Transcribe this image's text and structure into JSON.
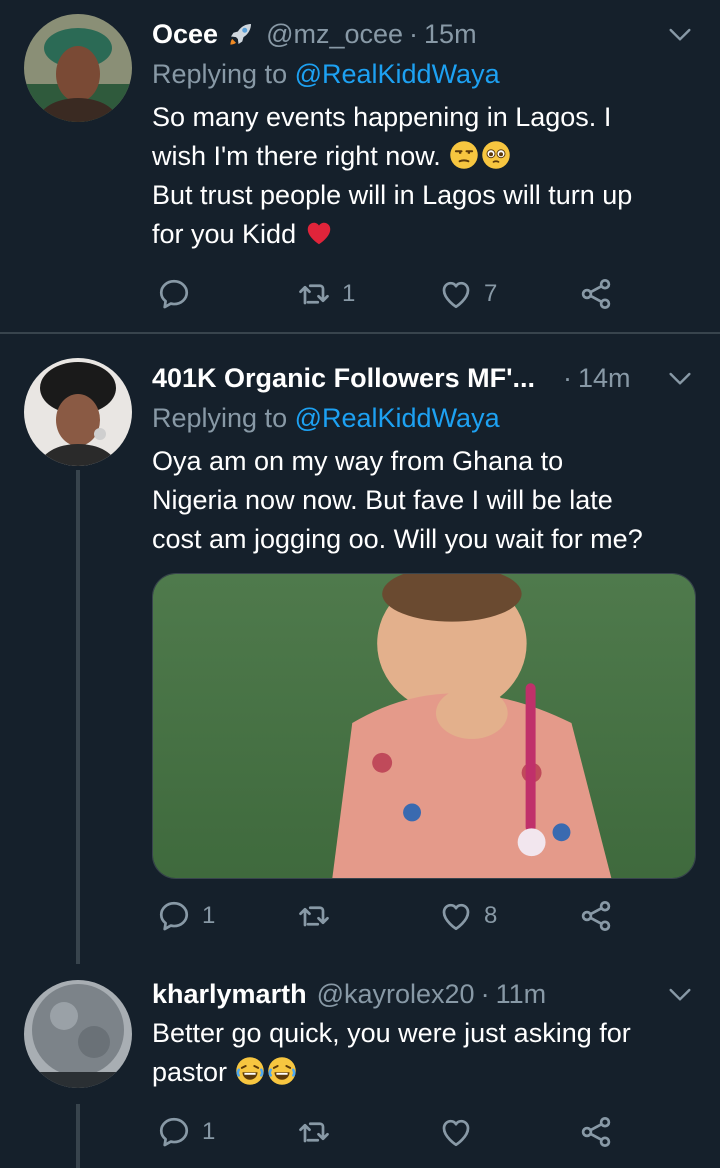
{
  "tweets": [
    {
      "name": "Ocee",
      "handle": "@mz_ocee",
      "separator": "·",
      "time": "15m",
      "replying_prefix": "Replying to ",
      "replying_to": "@RealKiddWaya",
      "body_lines": [
        "So many events happening in Lagos. I",
        "wish I'm there right now.",
        "But trust people will in Lagos will turn up",
        "for you Kidd"
      ],
      "reply_count": "",
      "retweet_count": "1",
      "like_count": "7"
    },
    {
      "name": "401K Organic Followers MF'...",
      "separator": "·",
      "time": "14m",
      "replying_prefix": "Replying to ",
      "replying_to": "@RealKiddWaya",
      "body_lines": [
        "Oya am on my way from Ghana to",
        "Nigeria now now. But fave I will be late",
        "cost am jogging oo. Will you wait for me?"
      ],
      "reply_count": "1",
      "retweet_count": "",
      "like_count": "8"
    },
    {
      "name": "kharlymarth",
      "handle": "@kayrolex20",
      "separator": "·",
      "time": "11m",
      "body_lines": [
        "Better go quick, you were just asking for",
        "pastor"
      ],
      "reply_count": "1",
      "retweet_count": "",
      "like_count": ""
    }
  ],
  "icons": {
    "reply": "reply-icon",
    "retweet": "retweet-icon",
    "like": "heart-icon",
    "share": "share-icon",
    "caret": "chevron-down-icon"
  },
  "colors": {
    "background": "#15202b",
    "muted": "#8899a6",
    "link": "#1da1f2",
    "divider": "#38444d"
  }
}
